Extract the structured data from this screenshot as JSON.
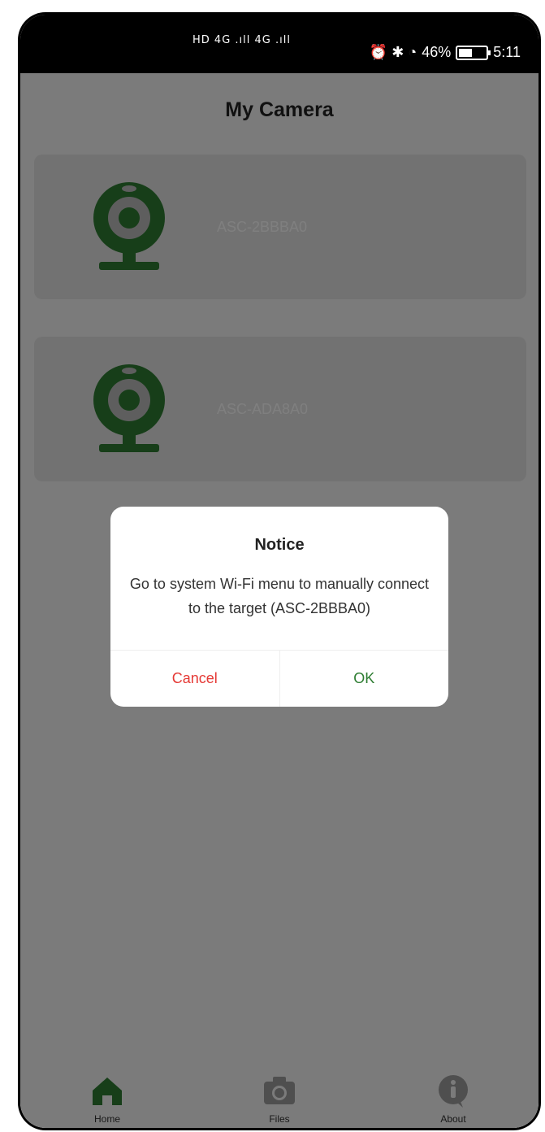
{
  "status_bar": {
    "left_indicators": "HD 4G .ıll 4G .ıll",
    "right_indicators": "⏰ ✱ ◔",
    "battery": "46%",
    "time": "5:11"
  },
  "header": {
    "title": "My Camera"
  },
  "cameras": [
    {
      "name": "ASC-2BBBA0",
      "icon": "webcam-icon"
    },
    {
      "name": "ASC-ADA8A0",
      "icon": "webcam-icon"
    }
  ],
  "dialog": {
    "title": "Notice",
    "message": "Go to system Wi-Fi menu to manually connect to the target (ASC-2BBBA0)",
    "cancel_label": "Cancel",
    "ok_label": "OK"
  },
  "bottom_nav": [
    {
      "label": "Home",
      "icon": "home-icon",
      "active": true
    },
    {
      "label": "Files",
      "icon": "camera-icon",
      "active": false
    },
    {
      "label": "About",
      "icon": "info-icon",
      "active": false
    }
  ],
  "colors": {
    "accent": "#2e7d32",
    "cancel": "#e53935",
    "ok": "#2e7d32",
    "inactive_icon": "#9e9e9e"
  }
}
